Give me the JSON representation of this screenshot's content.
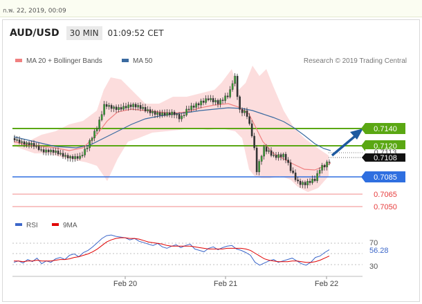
{
  "topbar": {
    "text": "ก.พ. 22, 2019, 00:09"
  },
  "header": {
    "pair": "AUD/USD",
    "timeframe": "30 MIN",
    "time": "01:09:52 CET"
  },
  "legend": {
    "ma20": "MA 20 + Bollinger Bands",
    "ma50": "MA 50",
    "credit": "Research © 2019 Trading Central"
  },
  "rsi_legend": {
    "rsi": "RSI",
    "ma": "9MA"
  },
  "colors": {
    "resistance": "#5aa713",
    "support": "#2f6fe0",
    "target": "#e63b3b",
    "ma20": "#f08080",
    "ma50": "#3a6aa0",
    "bands": "#fbd7d7",
    "arrow": "#1d5aa0",
    "rsi": "#3b66c9",
    "rsi_ma": "#e00000"
  },
  "chart_data": [
    {
      "type": "line",
      "x_ticks": [
        "Feb 20",
        "Feb 21",
        "Feb 22"
      ],
      "ylim": [
        0.7045,
        0.7155
      ],
      "levels": [
        {
          "value": 0.714,
          "label": "0.7140",
          "role": "resistance"
        },
        {
          "value": 0.712,
          "label": "0.7120",
          "role": "resistance"
        },
        {
          "value": 0.7113,
          "label": "0.7113",
          "role": "ma"
        },
        {
          "value": 0.7108,
          "label": "0.7108",
          "role": "last-price"
        },
        {
          "value": 0.7085,
          "label": "0.7085",
          "role": "pivot"
        },
        {
          "value": 0.7065,
          "label": "0.7065",
          "role": "target"
        },
        {
          "value": 0.705,
          "label": "0.7050",
          "role": "target"
        }
      ],
      "series": [
        {
          "name": "MA 20 + Bollinger Bands"
        },
        {
          "name": "MA 50"
        }
      ]
    },
    {
      "type": "line",
      "ylim": [
        20,
        80
      ],
      "y_ticks": [
        "70",
        "50",
        "30"
      ],
      "last_value": "56.28",
      "series": [
        {
          "name": "RSI",
          "values": [
            38,
            40,
            37,
            42,
            39,
            44,
            36,
            40,
            38,
            43,
            45,
            42,
            48,
            50,
            46,
            52,
            55,
            60,
            66,
            72,
            76,
            77,
            75,
            74,
            73,
            70,
            72,
            68,
            66,
            64,
            62,
            65,
            60,
            58,
            61,
            63,
            59,
            62,
            64,
            57,
            55,
            53,
            58,
            60,
            56,
            59,
            61,
            62,
            57,
            55,
            52,
            48,
            38,
            34,
            37,
            40,
            42,
            38,
            40,
            42,
            44,
            40,
            36,
            34,
            38,
            45,
            47,
            52,
            56
          ]
        },
        {
          "name": "9MA",
          "values": [
            40,
            40,
            39,
            40,
            40,
            41,
            40,
            40,
            40,
            41,
            42,
            42,
            43,
            45,
            46,
            48,
            50,
            53,
            57,
            62,
            67,
            70,
            72,
            73,
            73,
            72,
            72,
            71,
            69,
            67,
            66,
            65,
            64,
            62,
            61,
            61,
            61,
            61,
            61,
            60,
            59,
            58,
            57,
            57,
            57,
            57,
            58,
            58,
            58,
            58,
            57,
            55,
            51,
            47,
            43,
            41,
            40,
            39,
            39,
            39,
            40,
            40,
            39,
            38,
            38,
            39,
            41,
            44,
            47
          ]
        }
      ]
    }
  ]
}
